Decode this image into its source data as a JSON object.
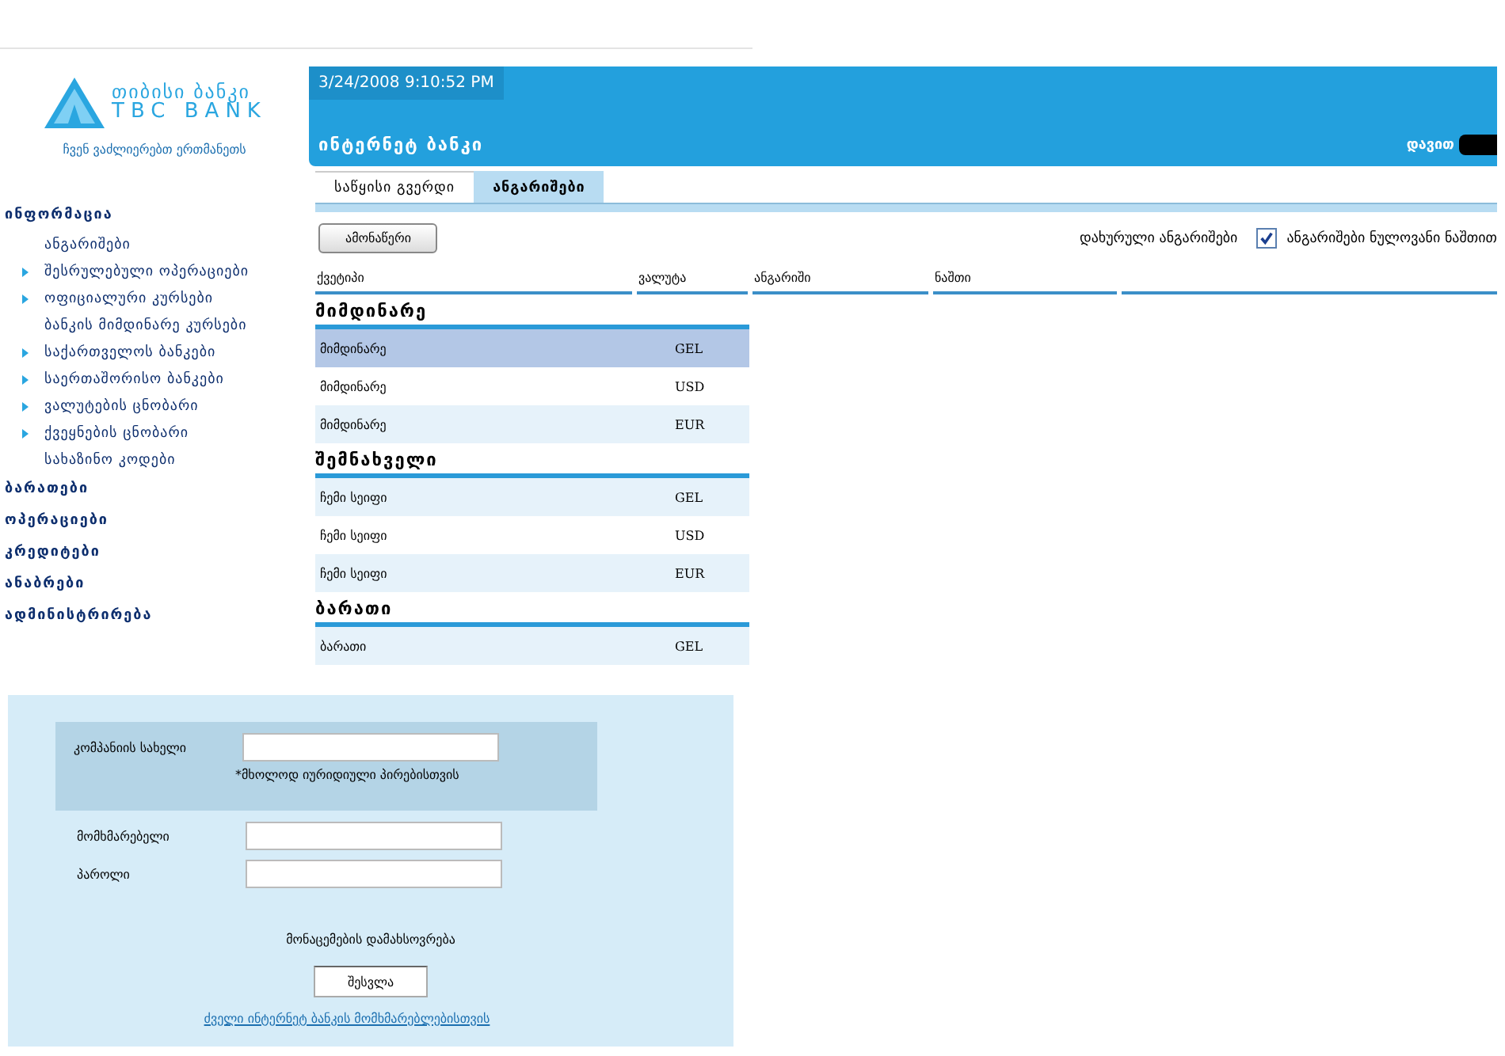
{
  "logo": {
    "name": "თიბისი ბანკი",
    "latin": "TBC BANK",
    "tagline": "ჩვენ ვაძლიერებთ ერთმანეთს"
  },
  "sidebar": {
    "items": [
      {
        "label": "ინფორმაცია",
        "children": [
          {
            "label": "ანგარიშები",
            "bullet": false
          },
          {
            "label": "შესრულებული ოპერაციები",
            "bullet": true
          },
          {
            "label": "ოფიციალური კურსები",
            "bullet": true
          },
          {
            "label": "ბანკის მიმდინარე კურსები",
            "bullet": false
          },
          {
            "label": "საქართველოს ბანკები",
            "bullet": true
          },
          {
            "label": "საერთაშორისო ბანკები",
            "bullet": true
          },
          {
            "label": "ვალუტების ცნობარი",
            "bullet": true
          },
          {
            "label": "ქვეყნების ცნობარი",
            "bullet": true
          },
          {
            "label": "სახაზინო კოდები",
            "bullet": false
          }
        ]
      },
      {
        "label": "ბარათები"
      },
      {
        "label": "ოპერაციები"
      },
      {
        "label": "კრედიტები"
      },
      {
        "label": "ანაბრები"
      },
      {
        "label": "ადმინისტრირება"
      }
    ]
  },
  "header": {
    "datetime": "3/24/2008 9:10:52 PM",
    "title": "ინტერნეტ ბანკი",
    "user": "დავით",
    "user_redacted": true
  },
  "tabs": [
    {
      "label": "საწყისი გვერდი",
      "selected": false
    },
    {
      "label": "ანგარიშები",
      "selected": true
    }
  ],
  "toolbar": {
    "button": "ამონაწერი",
    "closed_link": "დახურული ანგარიშები",
    "zero_balance": {
      "label": "ანგარიშები ნულოვანი ნაშთით",
      "checked": true
    }
  },
  "table": {
    "columns": [
      "ქვეტიპი",
      "ვალუტა",
      "ანგარიში",
      "ნაშთი"
    ],
    "groups": [
      {
        "title": "მიმდინარე",
        "rows": [
          {
            "subtype": "მიმდინარე",
            "currency": "GEL",
            "selected": true
          },
          {
            "subtype": "მიმდინარე",
            "currency": "USD",
            "selected": false
          },
          {
            "subtype": "მიმდინარე",
            "currency": "EUR",
            "selected": false
          }
        ]
      },
      {
        "title": "შემნახველი",
        "rows": [
          {
            "subtype": "ჩემი სეიფი",
            "currency": "GEL",
            "selected": false
          },
          {
            "subtype": "ჩემი სეიფი",
            "currency": "USD",
            "selected": false
          },
          {
            "subtype": "ჩემი სეიფი",
            "currency": "EUR",
            "selected": false
          }
        ]
      },
      {
        "title": "ბარათი",
        "rows": [
          {
            "subtype": "ბარათი",
            "currency": "GEL",
            "selected": false
          }
        ]
      }
    ]
  },
  "login": {
    "company_label": "კომპანიის სახელი",
    "company_note": "*მხოლოდ იურიდიული პირებისთვის",
    "user_label": "მომხმარებელი",
    "password_label": "პაროლი",
    "remember": "მონაცემების დამახსოვრება",
    "submit": "შესვლა",
    "old_users_link": "ძველი ინტერნეტ ბანკის მომხმარებლებისთვის"
  }
}
